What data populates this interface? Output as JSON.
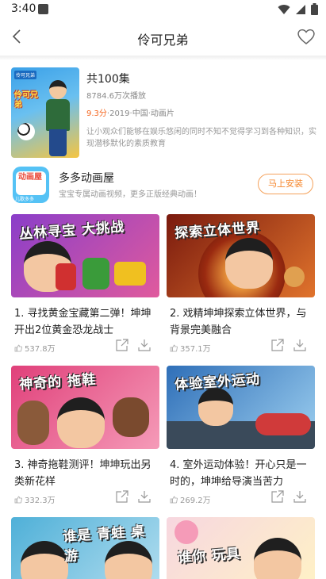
{
  "status_bar": {
    "time": "3:40"
  },
  "header": {
    "title": "伶可兄弟"
  },
  "show": {
    "episode_count": "共100集",
    "plays": "8784.6万次播放",
    "score": "9.3分",
    "meta": "·2019·中国·动画片",
    "description": "让小观众们能够在娱乐悠闲的同时不知不觉得学习到各种知识，实现潜移默化的素质教育",
    "poster_badge": "伶可兄弟"
  },
  "promo": {
    "logo_text": "动画屋",
    "logo_sub": "儿歌多多",
    "name": "多多动画屋",
    "description": "宝宝专属动画视频，更多正版经典动画！",
    "install_label": "马上安装"
  },
  "episodes": [
    {
      "caption": "丛林寻宝 大挑战",
      "title": "1. 寻找黄金宝藏第二弹！坤坤开出2位黄金恐龙战士",
      "views": "537.8万",
      "bg1": "#8a3ec9",
      "bg2": "#e05a9d"
    },
    {
      "caption": "探索立体世界",
      "title": "2. 戏精坤坤探索立体世界，与背景完美融合",
      "views": "357.1万",
      "bg1": "#7a1a0e",
      "bg2": "#e0732c"
    },
    {
      "caption": "神奇的 拖鞋",
      "title": "3. 神奇拖鞋测评！坤坤玩出另类新花样",
      "views": "332.3万",
      "bg1": "#e0407a",
      "bg2": "#f59bb8"
    },
    {
      "caption": "体验室外运动",
      "title": "4. 室外运动体验！开心只是一时的，坤坤给导演当苦力",
      "views": "269.2万",
      "bg1": "#2f6fb8",
      "bg2": "#9ed0f0"
    },
    {
      "caption": "谁是 青蛙 桌游",
      "title": "",
      "views": "",
      "bg1": "#4fb0d8",
      "bg2": "#b8e0f0"
    },
    {
      "caption": "谁你 玩具",
      "title": "",
      "views": "",
      "bg1": "#f7d7e0",
      "bg2": "#fff3c4"
    }
  ]
}
